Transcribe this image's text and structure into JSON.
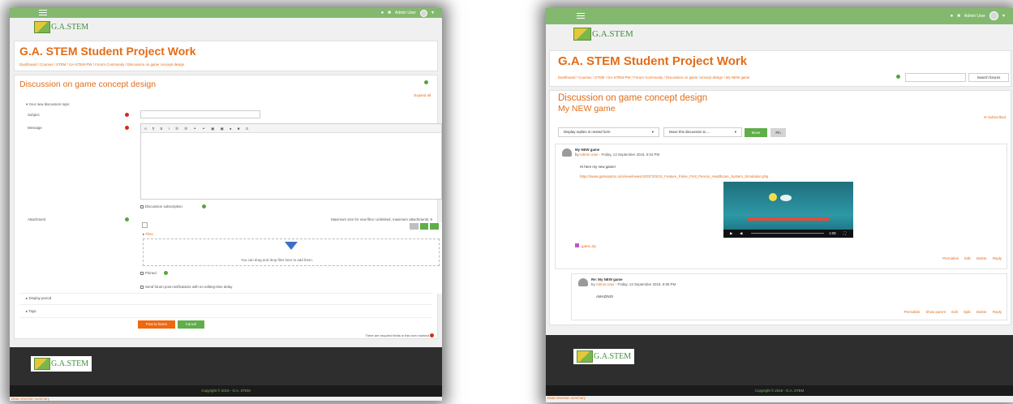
{
  "brand": {
    "logo_text": "G.A.STEM",
    "footer_logo_text": "G.A.STEM"
  },
  "navbar": {
    "user": "Admin User"
  },
  "site": {
    "title": "G.A. STEM Student Project Work"
  },
  "left": {
    "breadcrumbs": "Dashboard  /  Courses  /  STEM  /  GA-STEM-PW  /  Forum Community  /  Discussion on game concept design",
    "heading": "Discussion on game concept design",
    "expand_all": "Expand all",
    "section_new_topic": "Your new discussion topic",
    "label_subject": "Subject",
    "label_message": "Message",
    "discussion_subscription": "Discussion subscription",
    "label_attachment": "Attachment",
    "max_size": "Maximum size for new files: Unlimited, maximum attachments: 9",
    "files_label": "Files",
    "dropzone_text": "You can drag and drop files here to add them.",
    "pinned": "Pinned",
    "send_notifications": "Send forum post notifications with no editing-time delay",
    "display_period": "Display period",
    "tags": "Tags",
    "post_button": "Post to forum",
    "cancel_button": "Cancel",
    "required_note": "There are required fields in this form marked"
  },
  "right": {
    "breadcrumbs": "Dashboard  /  Courses  /  STEM  /  GA-STEM-PW  /  Forum Community  /  Discussion on game concept design  /  My NEW game",
    "search_button": "Search forums",
    "heading": "Discussion on game concept design",
    "subheading": "My NEW game",
    "subscribed": "Subscribed",
    "display_mode": "Display replies in nested form",
    "move_label": "Move this discussion to ...",
    "move_button": "Move",
    "pin_button": "Pin",
    "post1": {
      "title": "My NEW game",
      "by": "by",
      "author": "Admin User",
      "date": " - Friday, 13 September 2019, 5:04 PM",
      "body": "Hi here my new game!",
      "url": "https://www.gamasutra.com/view/news/100373/SGS_Feature_Pulse_First_Person_Healthcare_System_Simulation.php",
      "video_time": "1:09",
      "attachment": "game.zip",
      "actions": [
        "Permalink",
        "Edit",
        "Delete",
        "Reply"
      ]
    },
    "post2": {
      "title": "Re: My NEW game",
      "by": "by",
      "author": "Admin User",
      "date": " - Friday, 13 September 2019, 5:05 PM",
      "body": "AMAZING!",
      "actions": [
        "Permalink",
        "Show parent",
        "Edit",
        "Split",
        "Delete",
        "Reply"
      ]
    }
  },
  "footer": {
    "copyright": "Copyright © 2019 - G.A. STEM",
    "retention": "Data retention summary"
  },
  "colors": {
    "accent": "#e36c18",
    "navbar": "#83b96f",
    "primary_button": "#f0680f",
    "secondary_button": "#5fae4a"
  }
}
